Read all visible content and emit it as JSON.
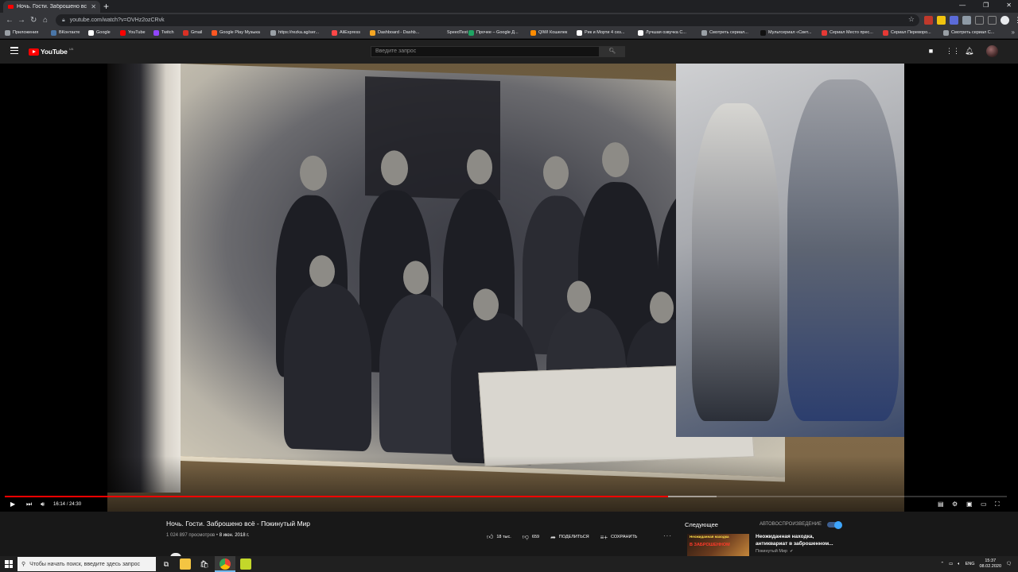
{
  "browser": {
    "tab_title": "Ночь. Гости. Заброшено вс",
    "url": "youtube.com/watch?v=OVHz2ozCRvk",
    "bookmarks": [
      {
        "label": "Приложения",
        "color": "#9aa0a6"
      },
      {
        "label": "ВКонтакте",
        "color": "#4a76a8"
      },
      {
        "label": "Google",
        "color": "#ffffff"
      },
      {
        "label": "YouTube",
        "color": "#ff0000"
      },
      {
        "label": "Twitch",
        "color": "#9146ff"
      },
      {
        "label": "Gmail",
        "color": "#d93025"
      },
      {
        "label": "Google Play Музыка",
        "color": "#ff5722"
      },
      {
        "label": "https://rezka.ag/ser...",
        "color": "#9aa0a6"
      },
      {
        "label": "AliExpress",
        "color": "#ff4747"
      },
      {
        "label": "Dashboard - Dashb...",
        "color": "#f5a623"
      },
      {
        "label": "SpeedTest",
        "color": "#35363a"
      },
      {
        "label": "Прочее – Google Д...",
        "color": "#1fa463"
      },
      {
        "label": "QIWI Кошелек",
        "color": "#ff8c00"
      },
      {
        "label": "Рик и Морти 4 сез...",
        "color": "#ffffff"
      },
      {
        "label": "Лучшая озвучка С...",
        "color": "#ffffff"
      },
      {
        "label": "Смотреть сериал...",
        "color": "#9aa0a6"
      },
      {
        "label": "Мультсериал «Свет...",
        "color": "#111111"
      },
      {
        "label": "Сериал Место прес...",
        "color": "#e53935"
      },
      {
        "label": "Сериал Переворо...",
        "color": "#e53935"
      },
      {
        "label": "Смотреть сериал С...",
        "color": "#9aa0a6"
      }
    ]
  },
  "youtube": {
    "logo_text": "YouTube",
    "logo_region": "UA",
    "search_placeholder": "Введите запрос"
  },
  "player": {
    "current_time": "16:14",
    "duration": "24:30",
    "time_sep": "/",
    "played_fraction": 0.662,
    "loaded_fraction": 0.71
  },
  "video": {
    "title": "Ночь. Гости. Заброшено всё - Покинутый Мир",
    "views": "1 024 897 просмотров",
    "dot": "•",
    "date": "8 июн. 2018 г.",
    "likes": "18 тыс.",
    "dislikes": "659",
    "share_label": "ПОДЕЛИТЬСЯ",
    "save_label": "СОХРАНИТЬ"
  },
  "sidebar": {
    "next_label": "Следующее",
    "autoplay_label": "АВТОВОСПРОИЗВЕДЕНИЕ",
    "autoplay_on": true,
    "next_video": {
      "thumb_text": "Неожиданная находка",
      "thumb_text2": "В ЗАБРОШЕННОМ",
      "title": "Неожиданная находка, антиквариат в заброшенном...",
      "channel": "Покинутый Мир"
    }
  },
  "taskbar": {
    "search_placeholder": "Чтобы начать поиск, введите здесь запрос",
    "language": "ENG",
    "time": "15:37",
    "date": "08.02.2020"
  },
  "colors": {
    "accent": "#ff0000",
    "toggle": "#3ea6ff"
  }
}
